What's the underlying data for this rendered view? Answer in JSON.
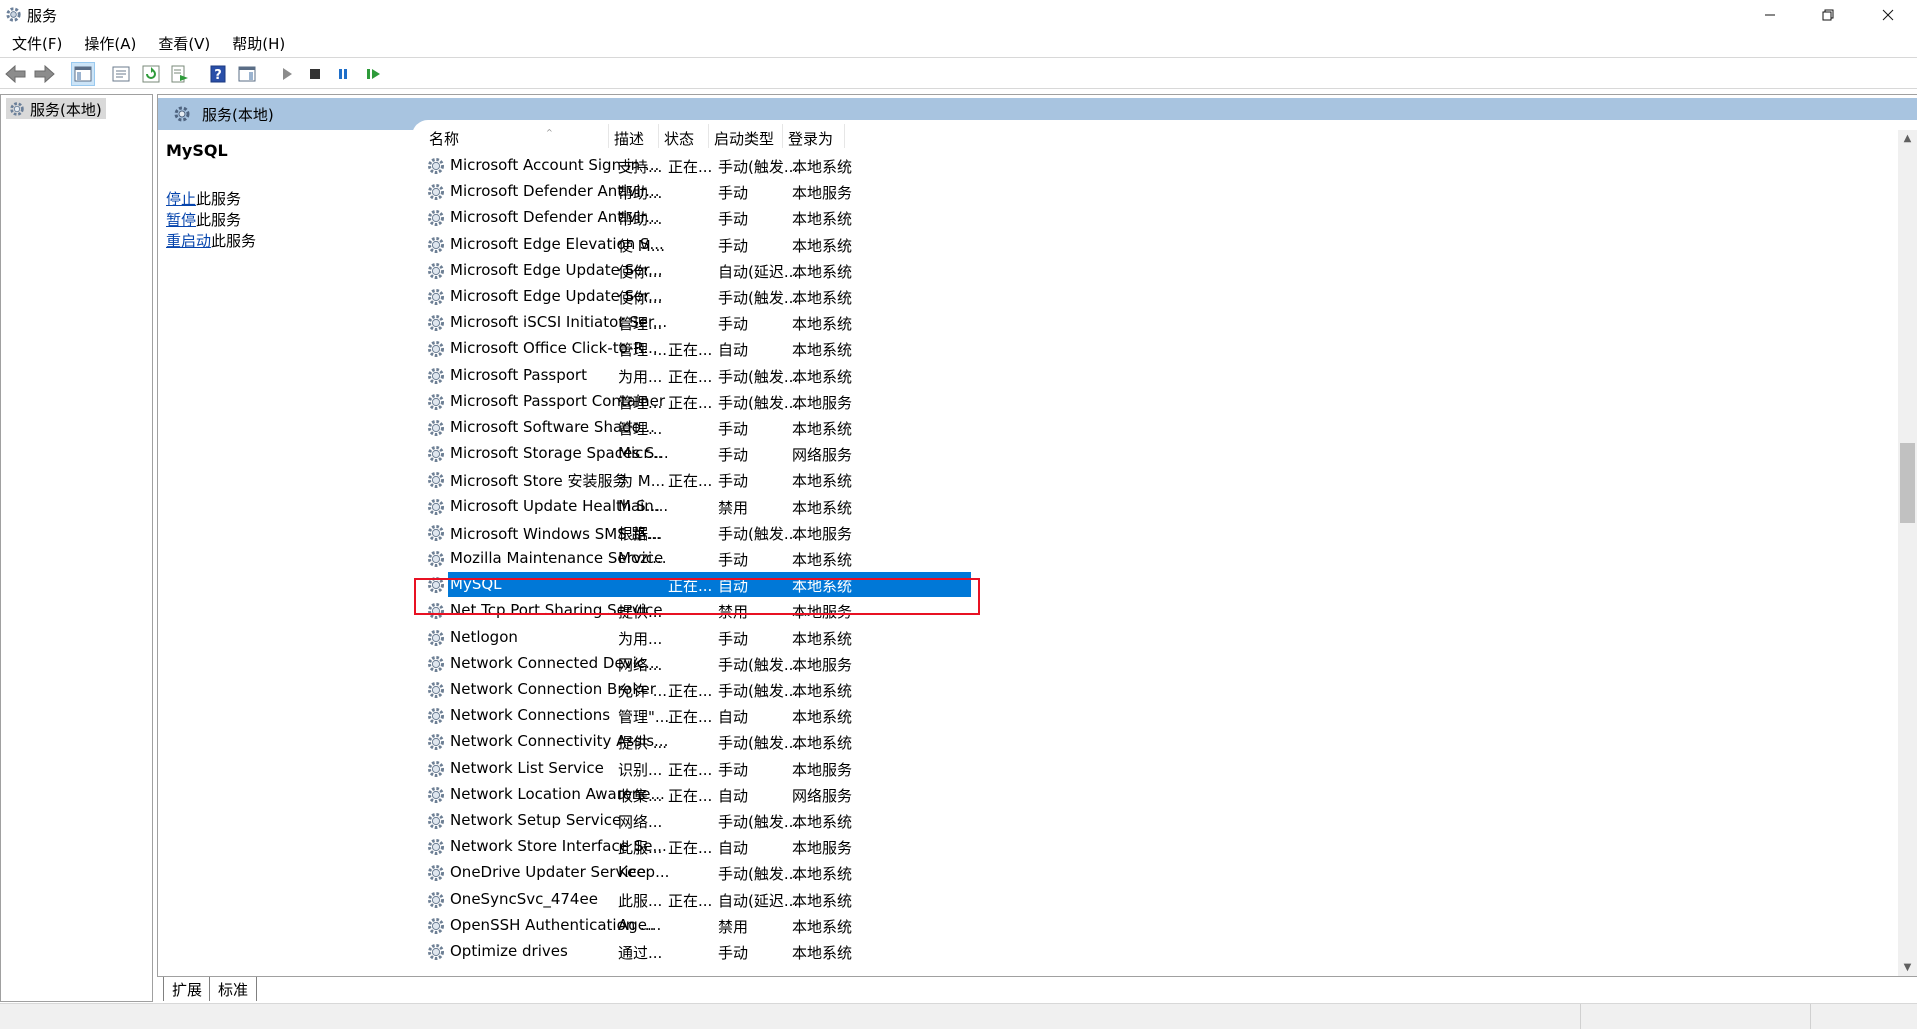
{
  "window": {
    "title": "服务"
  },
  "menu": [
    "文件(F)",
    "操作(A)",
    "查看(V)",
    "帮助(H)"
  ],
  "toolbar": [
    "back-icon",
    "forward-icon",
    "show-hide-console-tree-icon",
    "properties-icon",
    "refresh-icon",
    "export-list-icon",
    "help-icon",
    "action-pane-icon",
    "start-service-icon",
    "stop-service-icon",
    "pause-service-icon",
    "restart-service-icon"
  ],
  "tree": {
    "root": "服务(本地)"
  },
  "header": {
    "title": "服务(本地)"
  },
  "desc": {
    "service_name": "MySQL",
    "stop_link": "停止",
    "stop_suffix": "此服务",
    "pause_link": "暂停",
    "pause_suffix": "此服务",
    "restart_link": "重启动",
    "restart_suffix": "此服务"
  },
  "columns": {
    "name": "名称",
    "desc": "描述",
    "status": "状态",
    "startup": "启动类型",
    "logon": "登录为"
  },
  "rows": [
    {
      "name": "Microsoft Account Sign-in ...",
      "desc": "支持...",
      "status": "正在...",
      "startup": "手动(触发...",
      "logon": "本地系统"
    },
    {
      "name": "Microsoft Defender Antivir...",
      "desc": "帮助...",
      "status": "",
      "startup": "手动",
      "logon": "本地服务"
    },
    {
      "name": "Microsoft Defender Antivir...",
      "desc": "帮助...",
      "status": "",
      "startup": "手动",
      "logon": "本地系统"
    },
    {
      "name": "Microsoft Edge Elevation S...",
      "desc": "使 M...",
      "status": "",
      "startup": "手动",
      "logon": "本地系统"
    },
    {
      "name": "Microsoft Edge Update Ser...",
      "desc": "使你...",
      "status": "",
      "startup": "自动(延迟...",
      "logon": "本地系统"
    },
    {
      "name": "Microsoft Edge Update Ser...",
      "desc": "使你...",
      "status": "",
      "startup": "手动(触发...",
      "logon": "本地系统"
    },
    {
      "name": "Microsoft iSCSI Initiator Ser...",
      "desc": "管理...",
      "status": "",
      "startup": "手动",
      "logon": "本地系统"
    },
    {
      "name": "Microsoft Office Click-to-R...",
      "desc": "管理 ...",
      "status": "正在...",
      "startup": "自动",
      "logon": "本地系统"
    },
    {
      "name": "Microsoft Passport",
      "desc": "为用...",
      "status": "正在...",
      "startup": "手动(触发...",
      "logon": "本地系统"
    },
    {
      "name": "Microsoft Passport Container",
      "desc": "管理...",
      "status": "正在...",
      "startup": "手动(触发...",
      "logon": "本地服务"
    },
    {
      "name": "Microsoft Software Shado...",
      "desc": "管理...",
      "status": "",
      "startup": "手动",
      "logon": "本地系统"
    },
    {
      "name": "Microsoft Storage Spaces S...",
      "desc": "Micr...",
      "status": "",
      "startup": "手动",
      "logon": "网络服务"
    },
    {
      "name": "Microsoft Store 安装服务",
      "desc": "为 M...",
      "status": "正在...",
      "startup": "手动",
      "logon": "本地系统"
    },
    {
      "name": "Microsoft Update Health S...",
      "desc": "Main...",
      "status": "",
      "startup": "禁用",
      "logon": "本地系统"
    },
    {
      "name": "Microsoft Windows SMS 路...",
      "desc": "根据...",
      "status": "",
      "startup": "手动(触发...",
      "logon": "本地服务"
    },
    {
      "name": "Mozilla Maintenance Service",
      "desc": "Mozi...",
      "status": "",
      "startup": "手动",
      "logon": "本地系统"
    },
    {
      "name": "MySQL",
      "desc": "",
      "status": "正在...",
      "startup": "自动",
      "logon": "本地系统",
      "selected": true
    },
    {
      "name": "Net.Tcp Port Sharing Service",
      "desc": "提供...",
      "status": "",
      "startup": "禁用",
      "logon": "本地服务"
    },
    {
      "name": "Netlogon",
      "desc": "为用...",
      "status": "",
      "startup": "手动",
      "logon": "本地系统"
    },
    {
      "name": "Network Connected Devic...",
      "desc": "网络...",
      "status": "",
      "startup": "手动(触发...",
      "logon": "本地服务"
    },
    {
      "name": "Network Connection Broker",
      "desc": "允许 ...",
      "status": "正在...",
      "startup": "手动(触发...",
      "logon": "本地系统"
    },
    {
      "name": "Network Connections",
      "desc": "管理\"...",
      "status": "正在...",
      "startup": "自动",
      "logon": "本地系统"
    },
    {
      "name": "Network Connectivity Assis...",
      "desc": "提供 ...",
      "status": "",
      "startup": "手动(触发...",
      "logon": "本地系统"
    },
    {
      "name": "Network List Service",
      "desc": "识别...",
      "status": "正在...",
      "startup": "手动",
      "logon": "本地服务"
    },
    {
      "name": "Network Location Awarene...",
      "desc": "收集...",
      "status": "正在...",
      "startup": "自动",
      "logon": "网络服务"
    },
    {
      "name": "Network Setup Service",
      "desc": "网络...",
      "status": "",
      "startup": "手动(触发...",
      "logon": "本地系统"
    },
    {
      "name": "Network Store Interface Se...",
      "desc": "此服...",
      "status": "正在...",
      "startup": "自动",
      "logon": "本地服务"
    },
    {
      "name": "OneDrive Updater Service",
      "desc": "Keep...",
      "status": "",
      "startup": "手动(触发...",
      "logon": "本地系统"
    },
    {
      "name": "OneSyncSvc_474ee",
      "desc": "此服...",
      "status": "正在...",
      "startup": "自动(延迟...",
      "logon": "本地系统"
    },
    {
      "name": "OpenSSH Authentication ...",
      "desc": "Age...",
      "status": "",
      "startup": "禁用",
      "logon": "本地系统"
    },
    {
      "name": "Optimize drives",
      "desc": "通过...",
      "status": "",
      "startup": "手动",
      "logon": "本地系统"
    }
  ],
  "tabs": [
    "扩展",
    "标准"
  ],
  "colors": {
    "selection": "#0078d7",
    "header_band": "#a8c4e0",
    "highlight_box": "#e81123",
    "link": "#0645ad"
  }
}
